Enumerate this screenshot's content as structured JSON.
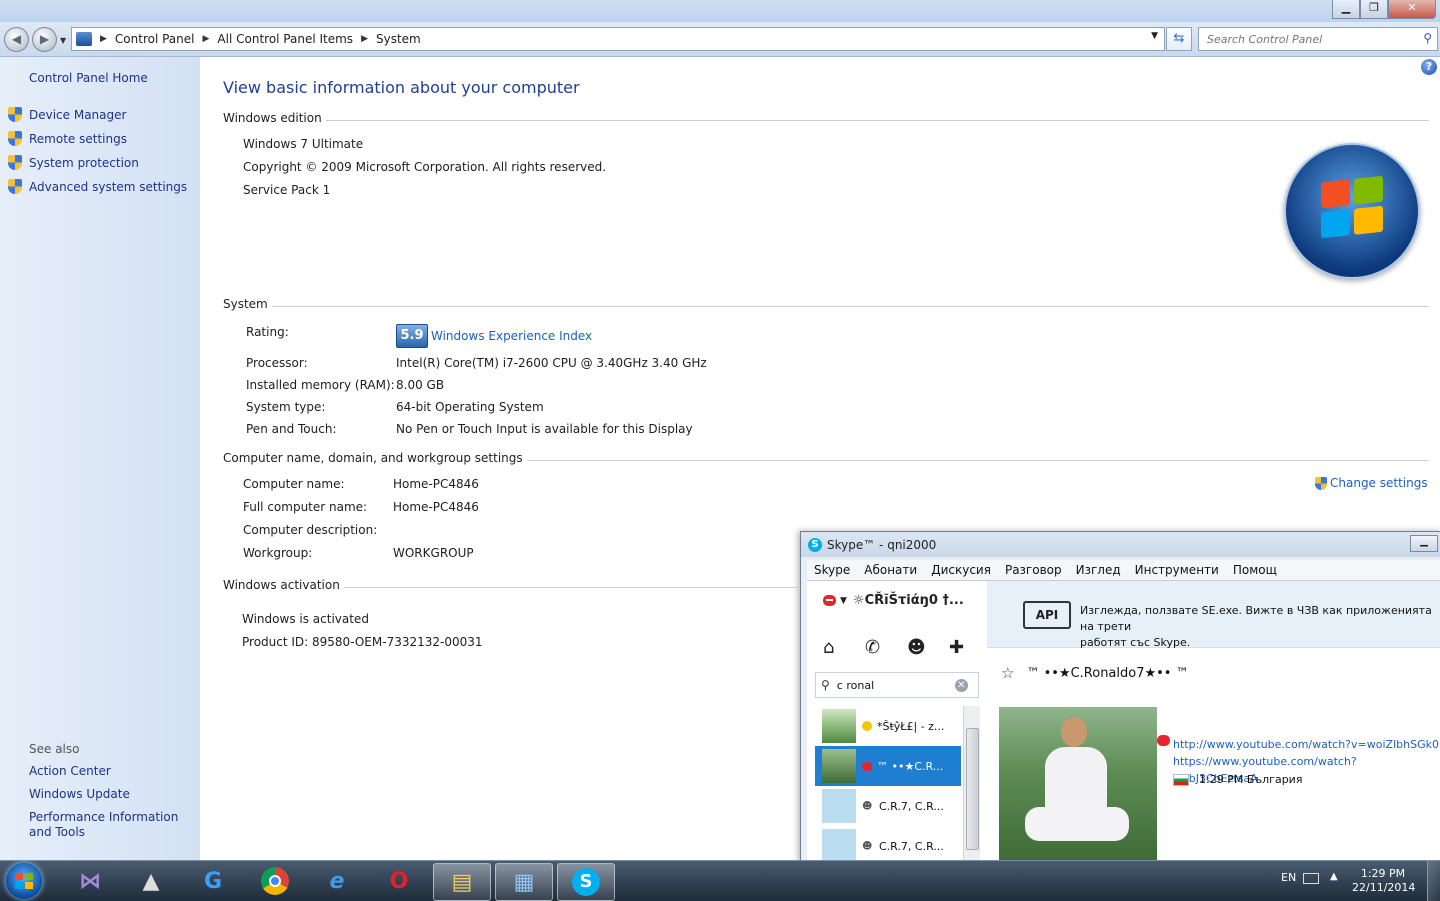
{
  "window": {
    "minimize": "▁",
    "maximize": "❐",
    "close": "✕"
  },
  "address_bar": {
    "crumbs": [
      "Control Panel",
      "All Control Panel Items",
      "System"
    ],
    "search_placeholder": "Search Control Panel"
  },
  "left_pane": {
    "home": "Control Panel Home",
    "tasks": [
      "Device Manager",
      "Remote settings",
      "System protection",
      "Advanced system settings"
    ],
    "see_also_title": "See also",
    "see_also": [
      "Action Center",
      "Windows Update",
      "Performance Information and Tools"
    ]
  },
  "main": {
    "title": "View basic information about your computer",
    "edition": {
      "heading": "Windows edition",
      "name": "Windows 7 Ultimate",
      "copyright": "Copyright © 2009 Microsoft Corporation.  All rights reserved.",
      "service_pack": "Service Pack 1"
    },
    "system": {
      "heading": "System",
      "rating_label": "Rating:",
      "rating_score": "5.9",
      "rating_link": "Windows Experience Index",
      "processor_label": "Processor:",
      "processor": "Intel(R) Core(TM) i7-2600 CPU @ 3.40GHz   3.40 GHz",
      "memory_label": "Installed memory (RAM):",
      "memory": "8.00 GB",
      "type_label": "System type:",
      "type": "64-bit Operating System",
      "pen_label": "Pen and Touch:",
      "pen": "No Pen or Touch Input is available for this Display"
    },
    "computer": {
      "heading": "Computer name, domain, and workgroup settings",
      "name_label": "Computer name:",
      "name": "Home-PC4846",
      "full_label": "Full computer name:",
      "full": "Home-PC4846",
      "desc_label": "Computer description:",
      "desc": "",
      "workgroup_label": "Workgroup:",
      "workgroup": "WORKGROUP",
      "change_settings": "Change settings"
    },
    "activation": {
      "heading": "Windows activation",
      "status": "Windows is activated",
      "product_id": "Product ID: 89580-OEM-7332132-00031"
    }
  },
  "skype": {
    "title": "Skype™ - qni2000",
    "menu": [
      "Skype",
      "Абонати",
      "Дискусия",
      "Разговор",
      "Изглед",
      "Инструменти",
      "Помощ"
    ],
    "user": "☼CŘĭŠτiάŋ0 †...",
    "search_value": "c ronal",
    "contacts": [
      {
        "name": "*ŠŧŷŁ£| - z..."
      },
      {
        "name": "™ ••★C.R..."
      },
      {
        "name": "C.R.7, C.R..."
      },
      {
        "name": "C.R.7, C.R..."
      }
    ],
    "notice_api": "API",
    "notice_text": "Изглежда, ползвате SE.exe. Вижте в ЧЗВ как приложенията на трети",
    "notice_text2": "работят със Skype.",
    "contact_title": "™ ••★C.Ronaldo7★•• ™",
    "links": [
      "http://www.youtube.com/watch?v=woiZlbhSGk0",
      "https://www.youtube.com/watch?v=bJ3CbEztsaA"
    ],
    "time_country": "1:29 PM България"
  },
  "taskbar": {
    "language": "EN",
    "time": "1:29 PM",
    "date": "22/11/2014"
  },
  "colors": {
    "link": "#1e5fc1",
    "title_blue": "#1e3e9a",
    "skype_blue": "#00aff0",
    "skype_selection": "#1e7fd1"
  }
}
